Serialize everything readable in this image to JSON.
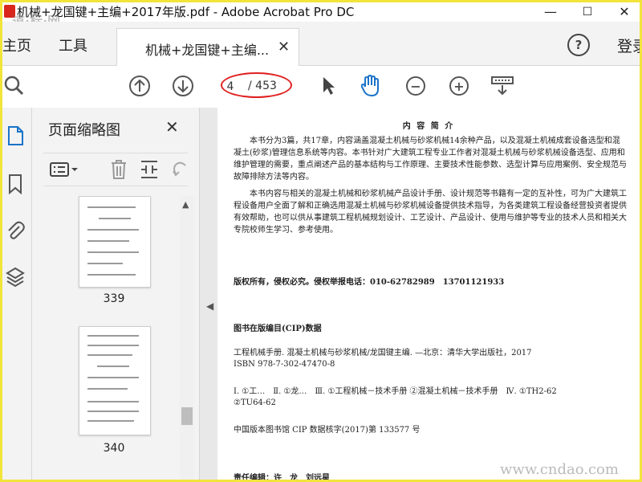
{
  "window": {
    "title": "机械+龙国键+主编+2017年版.pdf - Adobe Acrobat Pro DC",
    "minimize": "—",
    "maximize": "☐",
    "close": "✕"
  },
  "tabs": {
    "home": "主页",
    "tools": "工具",
    "document": "机械+龙国键+主编...",
    "document_close": "✕",
    "sign_in": "登录"
  },
  "toolbar": {
    "current_page": "4",
    "total_pages": "/ 453",
    "highlight_color": "#e02020"
  },
  "thumbnails_panel": {
    "title": "页面缩略图",
    "close": "✕",
    "thumbnails": [
      {
        "label": "339"
      },
      {
        "label": "340"
      }
    ]
  },
  "document": {
    "heading": "内 容 简 介",
    "para1": "本书分为3篇，共17章，内容涵盖混凝土机械与砂浆机械14余种产品，以及混凝土机械成套设备选型和混凝土(砂浆)管理信息系统等内容。本书针对广大建筑工程专业工作者对混凝土机械与砂浆机械设备选型、应用和维护管理的需要，重点阐述产品的基本结构与工作原理、主要技术性能参数、选型计算与应用案例、安全规范与故障排除方法等内容。",
    "para2": "本书内容与相关的混凝土机械和砂浆机械产品设计手册、设计规范等书籍有一定的互补性，可为广大建筑工程设备用户全面了解和正确选用混凝土机械与砂浆机械设备提供技术指导，为各类建筑工程设备经营投资者提供有效帮助，也可以供从事建筑工程机械规划设计、工艺设计、产品设计、使用与维护等专业的技术人员和相关大专院校师生学习、参考使用。",
    "copyright": "版权所有，侵权必究。侵权举报电话：010-62782989　13701121933",
    "cip_title": "图书在版编目(CIP)数据",
    "cip_line1": "工程机械手册. 混凝土机械与砂浆机械/龙国键主编. —北京：清华大学出版社，2017",
    "cip_line2": "ISBN 978-7-302-47470-8",
    "cip_line3": "Ⅰ. ①工…　Ⅱ. ①龙…　Ⅲ. ①工程机械－技术手册 ②混凝土机械－技术手册　Ⅳ. ①TH2-62",
    "cip_line4": "②TU64-62",
    "cip_line5": "中国版本图书馆 CIP 数据核字(2017)第 133577 号",
    "editor": "责任编辑：许　龙　刘远星",
    "watermark": "www.cndao.com",
    "corner_logo": "道·标·网"
  }
}
